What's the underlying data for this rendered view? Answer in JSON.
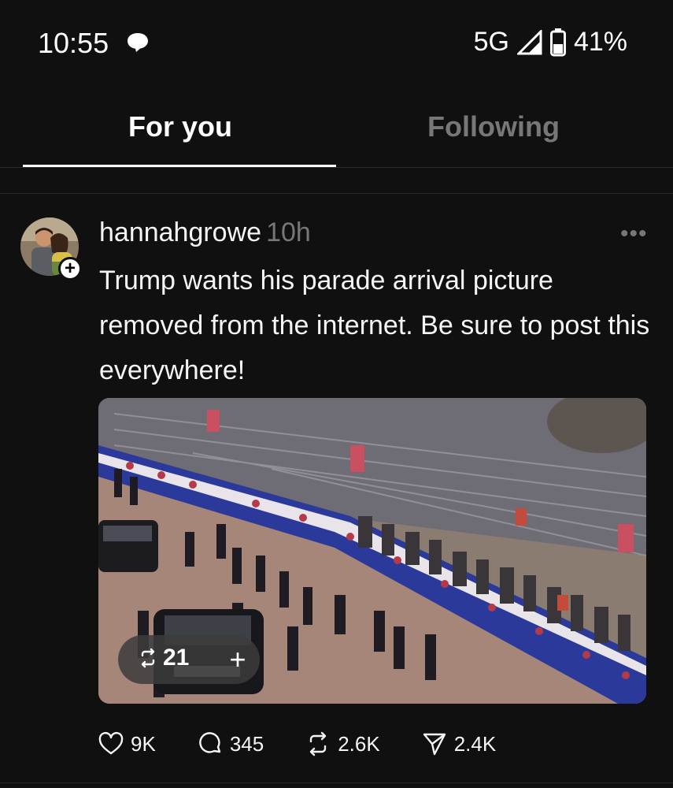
{
  "status_bar": {
    "time": "10:55",
    "network": "5G",
    "battery": "41%",
    "icons": [
      "chat-bubble-icon",
      "signal-icon",
      "battery-icon"
    ]
  },
  "tabs": [
    {
      "label": "For you",
      "active": true
    },
    {
      "label": "Following",
      "active": false
    }
  ],
  "post": {
    "username": "hannahgrowe",
    "time": "10h",
    "text": "Trump wants his parade arrival picture removed from the internet. Be sure to post this everywhere!",
    "repost_badge": {
      "count": "21"
    },
    "actions": {
      "likes": "9K",
      "replies": "345",
      "reposts": "2.6K",
      "shares": "2.4K"
    }
  },
  "colors": {
    "background": "#101010",
    "text_primary": "#f3f5f7",
    "text_secondary": "#777777",
    "divider": "#2a2a2a"
  }
}
